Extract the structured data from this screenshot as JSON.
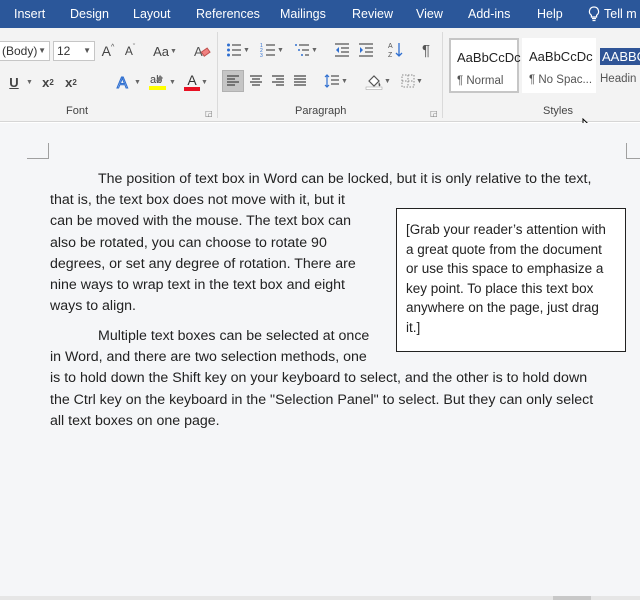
{
  "tabs": [
    {
      "label": "Insert"
    },
    {
      "label": "Design"
    },
    {
      "label": "Layout"
    },
    {
      "label": "References"
    },
    {
      "label": "Mailings"
    },
    {
      "label": "Review"
    },
    {
      "label": "View"
    },
    {
      "label": "Add-ins"
    },
    {
      "label": "Help"
    }
  ],
  "tell_me": {
    "label": "Tell m",
    "icon": "lightbulb-icon"
  },
  "font": {
    "name": "(Body)",
    "size": "12",
    "grow_label": "A",
    "shrink_label": "A",
    "case_label": "Aa",
    "underline_label": "U",
    "subscript_label": "x",
    "subscript_mark": "2",
    "superscript_label": "x",
    "superscript_mark": "2",
    "effects_label": "A",
    "color_label": "A",
    "highlight_color": "#ffff00",
    "font_color": "#e81123"
  },
  "groups": {
    "font": "Font",
    "paragraph": "Paragraph",
    "styles": "Styles"
  },
  "styles": [
    {
      "preview": "AaBbCcDc",
      "name": "¶ Normal",
      "selected": true
    },
    {
      "preview": "AaBbCcDc",
      "name": "¶ No Spac...",
      "selected": false
    },
    {
      "preview": "AABBC",
      "name": "Headin",
      "selected": false
    }
  ],
  "document": {
    "para1_lines": [
      "The position of text box in Word can be locked, but it is only relative to the text,",
      "that is, the text box does not move with it, but it",
      "can be moved with the mouse. The text box can",
      "also be rotated, you can choose to rotate 90",
      "degrees, or set any degree of rotation. There are",
      "nine ways to wrap text in the text box and eight",
      "ways to align."
    ],
    "para2_lines": [
      "Multiple text boxes can be selected at once",
      "in Word, and there are two selection methods, one",
      "is to hold down the Shift key on your keyboard to select, and the other is to hold down",
      "the Ctrl key on the keyboard in the \"Selection Panel\" to select. But they can only select",
      "all text boxes on one page."
    ],
    "textbox_lines": [
      "[Grab your reader’s attention with",
      "a great quote from the document",
      "or use this space to emphasize a",
      "key point. To place this text box",
      "anywhere on the page, just drag",
      "it.]"
    ]
  },
  "colors": {
    "tab_bar": "#2b579a",
    "ribbon": "#f3f3f3",
    "heading_style": "#2f5496"
  }
}
